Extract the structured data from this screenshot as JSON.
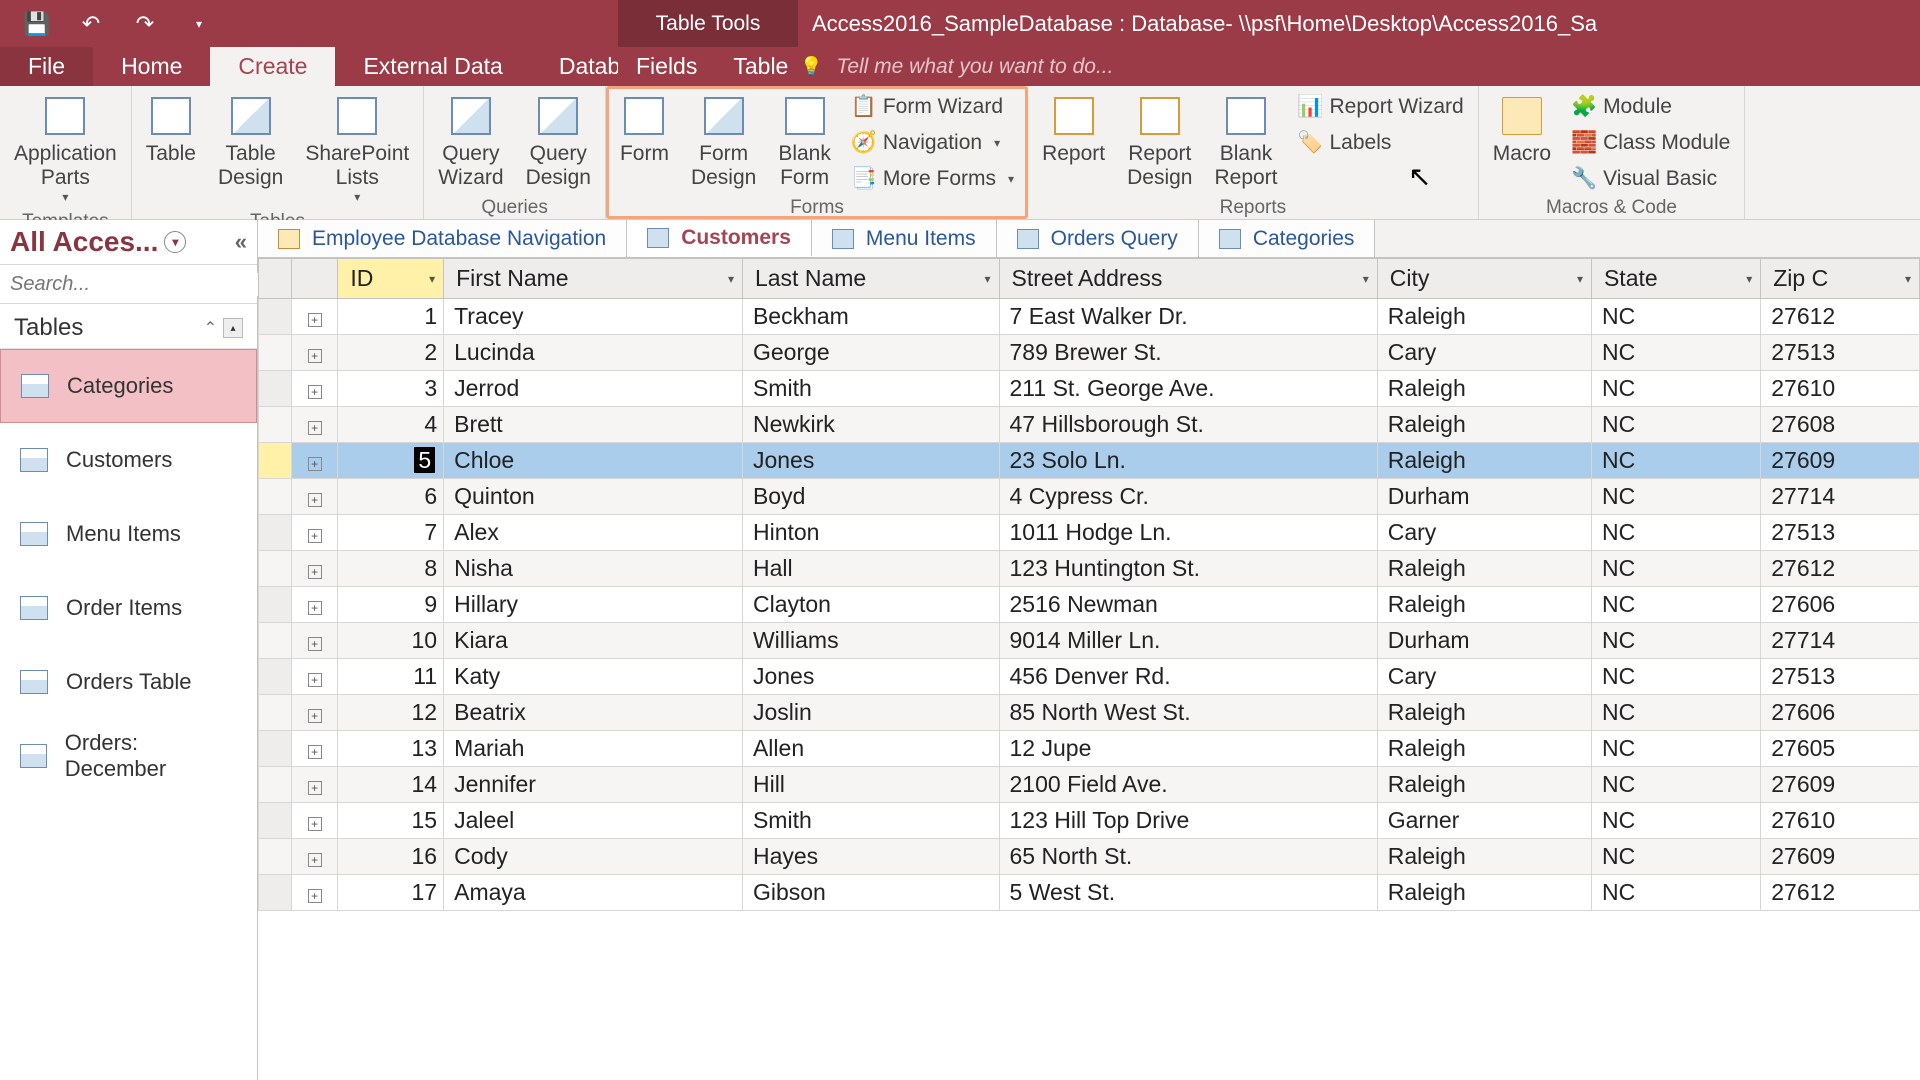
{
  "titlebar": {
    "tableTools": "Table Tools",
    "title": "Access2016_SampleDatabase : Database- \\\\psf\\Home\\Desktop\\Access2016_Sa"
  },
  "ribbonTabs": {
    "file": "File",
    "home": "Home",
    "create": "Create",
    "externalData": "External Data",
    "databaseTools": "Database Tools",
    "fields": "Fields",
    "table": "Table"
  },
  "tellMe": "Tell me what you want to do...",
  "ribbon": {
    "templates": {
      "appParts": "Application\nParts",
      "label": "Templates"
    },
    "tables": {
      "table": "Table",
      "tableDesign": "Table\nDesign",
      "sharepoint": "SharePoint\nLists",
      "label": "Tables"
    },
    "queries": {
      "wizard": "Query\nWizard",
      "design": "Query\nDesign",
      "label": "Queries"
    },
    "forms": {
      "form": "Form",
      "formDesign": "Form\nDesign",
      "blank": "Blank\nForm",
      "formWizard": "Form Wizard",
      "navigation": "Navigation",
      "moreForms": "More Forms",
      "label": "Forms"
    },
    "reports": {
      "report": "Report",
      "reportDesign": "Report\nDesign",
      "blank": "Blank\nReport",
      "reportWizard": "Report Wizard",
      "labels": "Labels",
      "label": "Reports"
    },
    "macros": {
      "macro": "Macro",
      "module": "Module",
      "classModule": "Class Module",
      "visualBasic": "Visual Basic",
      "label": "Macros & Code"
    }
  },
  "nav": {
    "headerLabel": "All Acces...",
    "searchPlaceholder": "Search...",
    "section": "Tables",
    "items": [
      {
        "label": "Categories",
        "selected": true
      },
      {
        "label": "Customers"
      },
      {
        "label": "Menu Items"
      },
      {
        "label": "Order Items"
      },
      {
        "label": "Orders Table"
      },
      {
        "label": "Orders: December"
      }
    ]
  },
  "docTabs": [
    {
      "label": "Employee Database Navigation",
      "type": "form"
    },
    {
      "label": "Customers",
      "active": true
    },
    {
      "label": "Menu Items"
    },
    {
      "label": "Orders Query"
    },
    {
      "label": "Categories"
    }
  ],
  "columns": [
    "ID",
    "First Name",
    "Last Name",
    "Street Address",
    "City",
    "State",
    "Zip Co"
  ],
  "zipHeaderVisible": "Zip C",
  "rows": [
    {
      "id": 1,
      "fn": "Tracey",
      "ln": "Beckham",
      "addr": "7 East Walker Dr.",
      "city": "Raleigh",
      "st": "NC",
      "zip": "27612"
    },
    {
      "id": 2,
      "fn": "Lucinda",
      "ln": "George",
      "addr": "789 Brewer St.",
      "city": "Cary",
      "st": "NC",
      "zip": "27513"
    },
    {
      "id": 3,
      "fn": "Jerrod",
      "ln": "Smith",
      "addr": "211 St. George Ave.",
      "city": "Raleigh",
      "st": "NC",
      "zip": "27610"
    },
    {
      "id": 4,
      "fn": "Brett",
      "ln": "Newkirk",
      "addr": "47 Hillsborough St.",
      "city": "Raleigh",
      "st": "NC",
      "zip": "27608"
    },
    {
      "id": 5,
      "fn": "Chloe",
      "ln": "Jones",
      "addr": "23 Solo Ln.",
      "city": "Raleigh",
      "st": "NC",
      "zip": "27609",
      "selected": true
    },
    {
      "id": 6,
      "fn": "Quinton",
      "ln": "Boyd",
      "addr": "4 Cypress Cr.",
      "city": "Durham",
      "st": "NC",
      "zip": "27714"
    },
    {
      "id": 7,
      "fn": "Alex",
      "ln": "Hinton",
      "addr": "1011 Hodge Ln.",
      "city": "Cary",
      "st": "NC",
      "zip": "27513"
    },
    {
      "id": 8,
      "fn": "Nisha",
      "ln": "Hall",
      "addr": "123 Huntington St.",
      "city": "Raleigh",
      "st": "NC",
      "zip": "27612"
    },
    {
      "id": 9,
      "fn": "Hillary",
      "ln": "Clayton",
      "addr": "2516 Newman",
      "city": "Raleigh",
      "st": "NC",
      "zip": "27606"
    },
    {
      "id": 10,
      "fn": "Kiara",
      "ln": "Williams",
      "addr": "9014 Miller Ln.",
      "city": "Durham",
      "st": "NC",
      "zip": "27714"
    },
    {
      "id": 11,
      "fn": "Katy",
      "ln": "Jones",
      "addr": "456 Denver Rd.",
      "city": "Cary",
      "st": "NC",
      "zip": "27513"
    },
    {
      "id": 12,
      "fn": "Beatrix",
      "ln": "Joslin",
      "addr": "85 North West St.",
      "city": "Raleigh",
      "st": "NC",
      "zip": "27606"
    },
    {
      "id": 13,
      "fn": "Mariah",
      "ln": "Allen",
      "addr": "12 Jupe",
      "city": "Raleigh",
      "st": "NC",
      "zip": "27605"
    },
    {
      "id": 14,
      "fn": "Jennifer",
      "ln": "Hill",
      "addr": "2100 Field Ave.",
      "city": "Raleigh",
      "st": "NC",
      "zip": "27609"
    },
    {
      "id": 15,
      "fn": "Jaleel",
      "ln": "Smith",
      "addr": "123 Hill Top Drive",
      "city": "Garner",
      "st": "NC",
      "zip": "27610"
    },
    {
      "id": 16,
      "fn": "Cody",
      "ln": "Hayes",
      "addr": "65 North St.",
      "city": "Raleigh",
      "st": "NC",
      "zip": "27609"
    },
    {
      "id": 17,
      "fn": "Amaya",
      "ln": "Gibson",
      "addr": "5 West St.",
      "city": "Raleigh",
      "st": "NC",
      "zip": "27612"
    }
  ]
}
